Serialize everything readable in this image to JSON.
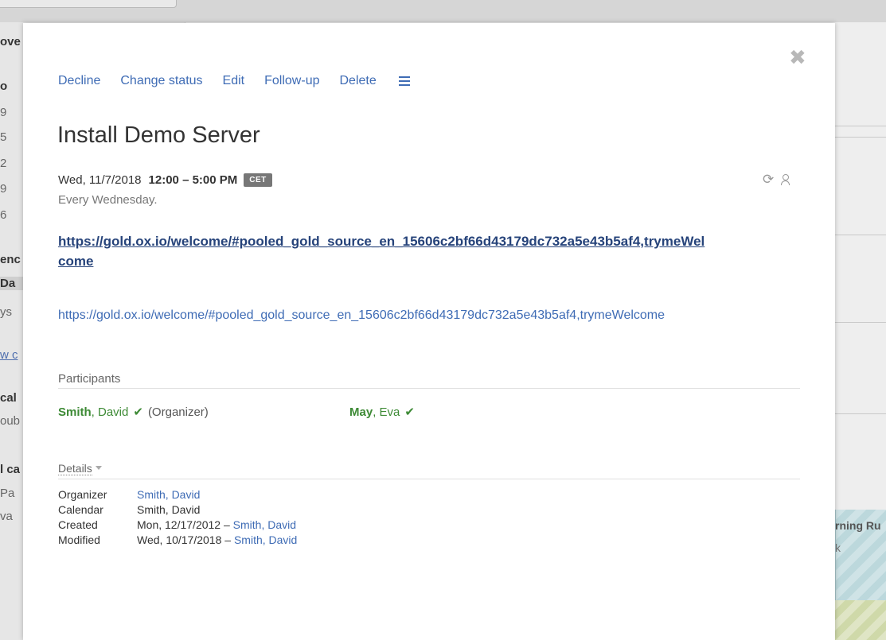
{
  "background": {
    "fragments": [
      "ove",
      "o",
      "9",
      "5",
      "2",
      "9",
      "6",
      "enc",
      "Da",
      "ys",
      "w c",
      "cal",
      "oub",
      "l ca",
      "Pa",
      "va"
    ],
    "event_title": "rning Ru",
    "event_sub": "k"
  },
  "dialog": {
    "close_label": "✖",
    "toolbar": {
      "decline": "Decline",
      "change_status": "Change status",
      "edit": "Edit",
      "follow_up": "Follow-up",
      "delete": "Delete"
    },
    "title": "Install Demo Server",
    "date": "Wed, 11/7/2018",
    "time": "12:00 – 5:00 PM",
    "timezone": "CET",
    "recurrence": "Every Wednesday.",
    "reload_icon": "⟳",
    "description_bold_link": "https://gold.ox.io/welcome/#pooled_gold_source_en_15606c2bf66d43179dc732a5e43b5af4,trymeWelcome",
    "description_link": "https://gold.ox.io/welcome/#pooled_gold_source_en_15606c2bf66d43179dc732a5e43b5af4,trymeWelcome",
    "participants_label": "Participants",
    "participants": [
      {
        "last": "Smith",
        "first": ", David",
        "check": "✔",
        "role": "(Organizer)"
      },
      {
        "last": "May",
        "first": ", Eva",
        "check": "✔",
        "role": ""
      }
    ],
    "details_label": "Details",
    "details": {
      "organizer_key": "Organizer",
      "organizer_value": "Smith, David",
      "calendar_key": "Calendar",
      "calendar_value": "Smith, David",
      "created_key": "Created",
      "created_date": "Mon, 12/17/2012 – ",
      "created_by": "Smith, David",
      "modified_key": "Modified",
      "modified_date": "Wed, 10/17/2018 – ",
      "modified_by": "Smith, David"
    }
  },
  "colors": {
    "link": "#3f6cb5",
    "accepted": "#3d8a35",
    "bold_link": "#26437a"
  }
}
